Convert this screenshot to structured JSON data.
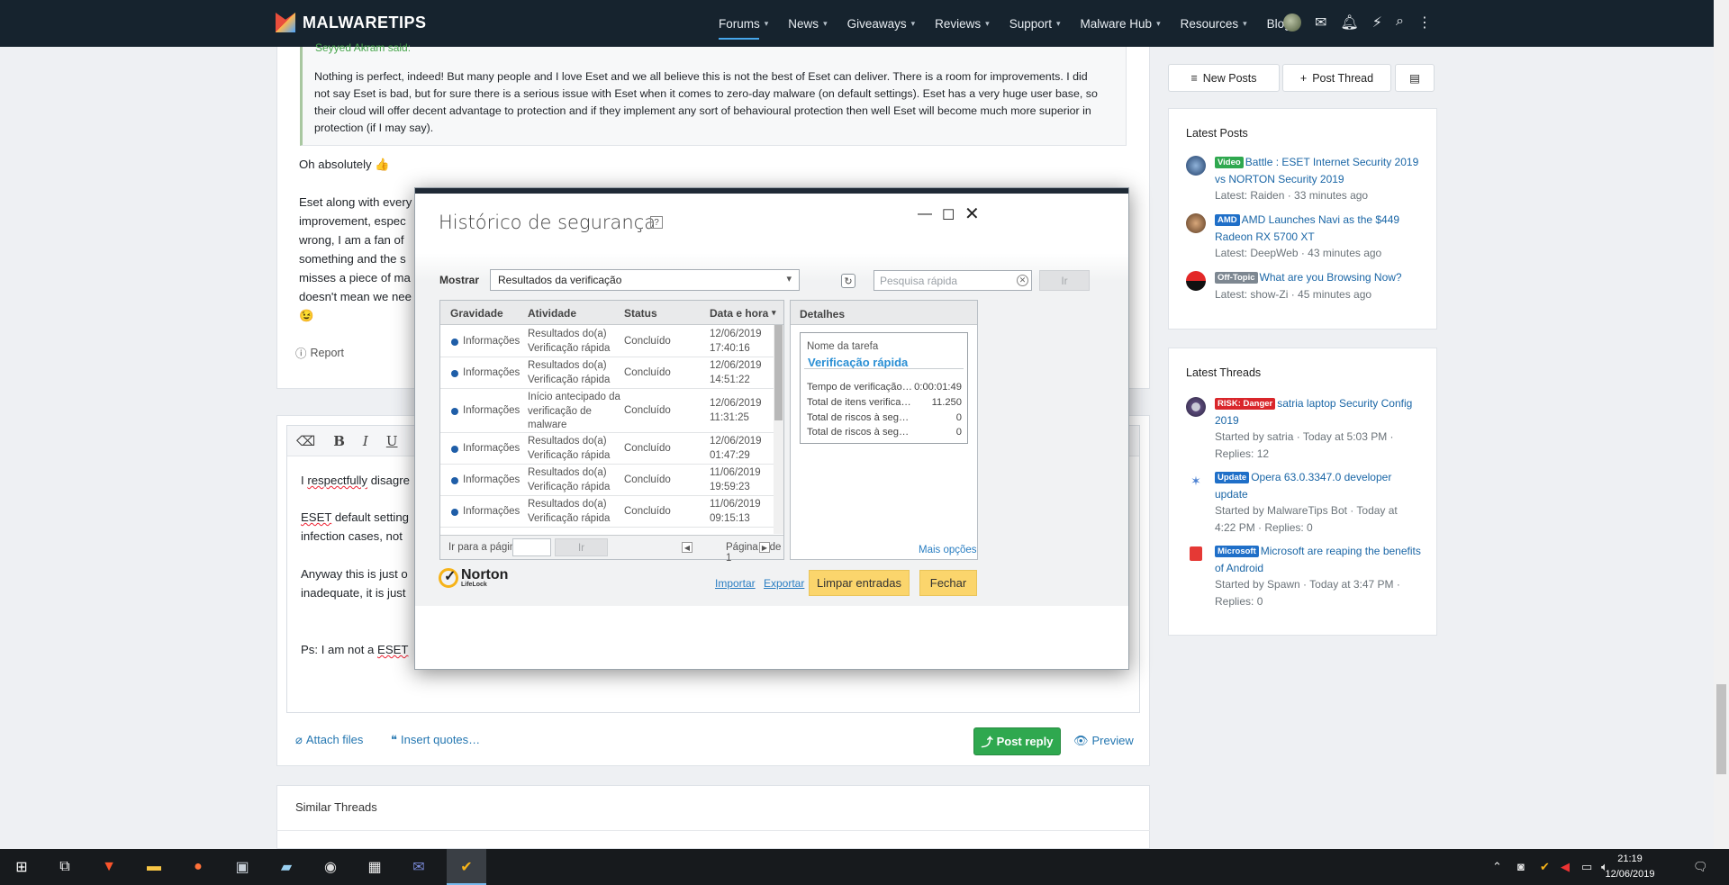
{
  "nav": {
    "logo": "MALWARETIPS",
    "items": [
      "Forums",
      "News",
      "Giveaways",
      "Reviews",
      "Support",
      "Malware Hub",
      "Resources",
      "Blogs"
    ]
  },
  "post": {
    "quote_author": "Seyyed Akram said:",
    "quote_text": "Nothing is perfect, indeed! But many people and I love Eset and we all believe this is not the best of Eset can deliver. There is a room for improvements. I did not say Eset is bad, but for sure there is a serious issue with Eset when it comes to zero-day malware (on default settings). Eset has a very huge user base, so their cloud will offer decent advantage to protection and if they implement any sort of behavioural protection then well Eset will become much more superior in protection (if I may say).",
    "lines": [
      "Oh absolutely 👍",
      "Eset along with every",
      "improvement, espec",
      "wrong, I am a fan of",
      "something and the s",
      "misses a piece of ma",
      "doesn't mean we nee",
      "😉"
    ],
    "report": "Report"
  },
  "editor": {
    "line1_a": "I ",
    "line1_b": "respectfully",
    "line1_c": " disagre",
    "line2_a": "ESET",
    "line2_b": " default setting",
    "line3": "infection cases, not",
    "line4": "Anyway this is just o",
    "line5": "inadequate, it is just",
    "line6_a": "Ps: I am not a ",
    "line6_b": "ESET"
  },
  "actions": {
    "attach": "Attach files",
    "insert": "Insert quotes…",
    "post_reply": "Post reply",
    "preview": "Preview"
  },
  "similar": {
    "title": "Similar Threads"
  },
  "sidebar": {
    "new_posts": "New Posts",
    "post_thread": "Post Thread",
    "latest_posts_title": "Latest Posts",
    "latest_posts": [
      {
        "badge": "Video",
        "badge_color": "#2fa84f",
        "title": "Battle : ESET Internet Security 2019 vs NORTON Security 2019",
        "meta": "Latest: Raiden · 33 minutes ago"
      },
      {
        "badge": "AMD",
        "badge_color": "#1f6fc8",
        "title": "AMD Launches Navi as the $449 Radeon RX 5700 XT",
        "meta": "Latest: DeepWeb · 43 minutes ago"
      },
      {
        "badge": "Off-Topic",
        "badge_color": "#7d8791",
        "title": "What are you Browsing Now?",
        "meta": "Latest: show-Zi · 45 minutes ago"
      }
    ],
    "latest_threads_title": "Latest Threads",
    "latest_threads": [
      {
        "badge": "RISK: Danger",
        "badge_color": "#d9262b",
        "title": "satria laptop Security Config 2019",
        "meta1": "Started by satria · Today at 5:03 PM ·",
        "meta2": "Replies: 12"
      },
      {
        "badge": "Update",
        "badge_color": "#1f6fc8",
        "title": "Opera 63.0.3347.0 developer update",
        "meta1": "Started by MalwareTips Bot · Today at",
        "meta2": "4:22 PM · Replies: 0"
      },
      {
        "badge": "Microsoft",
        "badge_color": "#1f6fc8",
        "title": "Microsoft are reaping the benefits of Android",
        "meta1": "Started by Spawn · Today at 3:47 PM ·",
        "meta2": "Replies: 0"
      }
    ]
  },
  "dialog": {
    "title": "Histórico de segurança",
    "help": "?",
    "show_label": "Mostrar",
    "show_value": "Resultados da verificação",
    "search_placeholder": "Pesquisa rápida",
    "go": "Ir",
    "columns": [
      "Gravidade",
      "Atividade",
      "Status",
      "Data e hora"
    ],
    "rows": [
      {
        "severity": "Informações",
        "activity": [
          "Resultados do(a)",
          "Verificação rápida"
        ],
        "status": "Concluído",
        "date": "12/06/2019",
        "time": "17:40:16"
      },
      {
        "severity": "Informações",
        "activity": [
          "Resultados do(a)",
          "Verificação rápida"
        ],
        "status": "Concluído",
        "date": "12/06/2019",
        "time": "14:51:22"
      },
      {
        "severity": "Informações",
        "activity": [
          "Início antecipado da",
          "verificação de",
          "malware"
        ],
        "status": "Concluído",
        "date": "12/06/2019",
        "time": "11:31:25"
      },
      {
        "severity": "Informações",
        "activity": [
          "Resultados do(a)",
          "Verificação rápida"
        ],
        "status": "Concluído",
        "date": "12/06/2019",
        "time": "01:47:29"
      },
      {
        "severity": "Informações",
        "activity": [
          "Resultados do(a)",
          "Verificação rápida"
        ],
        "status": "Concluído",
        "date": "11/06/2019",
        "time": "19:59:23"
      },
      {
        "severity": "Informações",
        "activity": [
          "Resultados do(a)",
          "Verificação rápida"
        ],
        "status": "Concluído",
        "date": "11/06/2019",
        "time": "09:15:13"
      }
    ],
    "goto_label": "Ir para a página:",
    "page_label": "Página 1 de 1",
    "details_title": "Detalhes",
    "task_name_label": "Nome da tarefa",
    "task_name": "Verificação rápida",
    "details": [
      {
        "k": "Tempo de verificação (d:h...",
        "v": "0:00:01:49"
      },
      {
        "k": "Total de itens verificados",
        "v": "11.250"
      },
      {
        "k": "Total de riscos à seguranç...",
        "v": "0"
      },
      {
        "k": "Total de riscos à seguranç...",
        "v": "0"
      }
    ],
    "more_options": "Mais opções",
    "import": "Importar",
    "export": "Exportar",
    "clear": "Limpar entradas",
    "close": "Fechar",
    "brand": "Norton",
    "brand_sub": "LifeLock"
  },
  "taskbar": {
    "time": "21:19",
    "date": "12/06/2019"
  }
}
